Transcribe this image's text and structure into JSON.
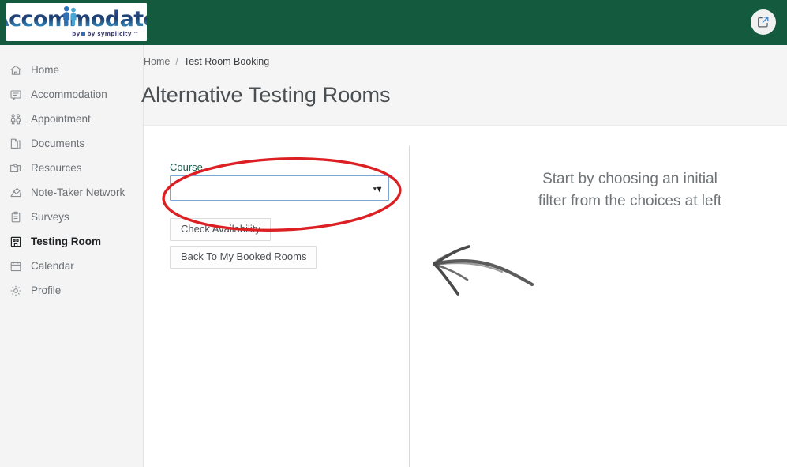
{
  "brand": {
    "logo_word": "Accommodate",
    "logo_tagline": "by symplicity",
    "logo_tm": "™",
    "header_color": "#145a3e"
  },
  "header": {
    "external_link_icon": "external-link-icon"
  },
  "sidebar": {
    "items": [
      {
        "label": "Home",
        "icon": "home-icon",
        "active": false
      },
      {
        "label": "Accommodation",
        "icon": "chat-bubble-icon",
        "active": false
      },
      {
        "label": "Appointment",
        "icon": "people-icon",
        "active": false
      },
      {
        "label": "Documents",
        "icon": "document-icon",
        "active": false
      },
      {
        "label": "Resources",
        "icon": "folder-icon",
        "active": false
      },
      {
        "label": "Note-Taker Network",
        "icon": "note-pencil-icon",
        "active": false
      },
      {
        "label": "Surveys",
        "icon": "clipboard-icon",
        "active": false
      },
      {
        "label": "Testing Room",
        "icon": "building-icon",
        "active": true
      },
      {
        "label": "Calendar",
        "icon": "calendar-icon",
        "active": false
      },
      {
        "label": "Profile",
        "icon": "gear-icon",
        "active": false
      }
    ]
  },
  "breadcrumb": {
    "home": "Home",
    "separator": "/",
    "current": "Test Room Booking"
  },
  "page": {
    "title": "Alternative Testing Rooms"
  },
  "filters": {
    "course_label": "Course",
    "course_value": "",
    "course_placeholder": "",
    "course_options": [
      ""
    ],
    "check_availability_label": "Check Availability",
    "back_to_booked_label": "Back To My Booked Rooms",
    "select_border_color": "#7aa7d8",
    "label_color": "#1d5a4a"
  },
  "empty_state": {
    "message": "Start by choosing an initial filter from the choices at left",
    "arrow_icon": "hand-drawn-arrow-left-icon"
  },
  "annotation": {
    "ellipse_color": "#dc1f22",
    "target": "course-select"
  }
}
